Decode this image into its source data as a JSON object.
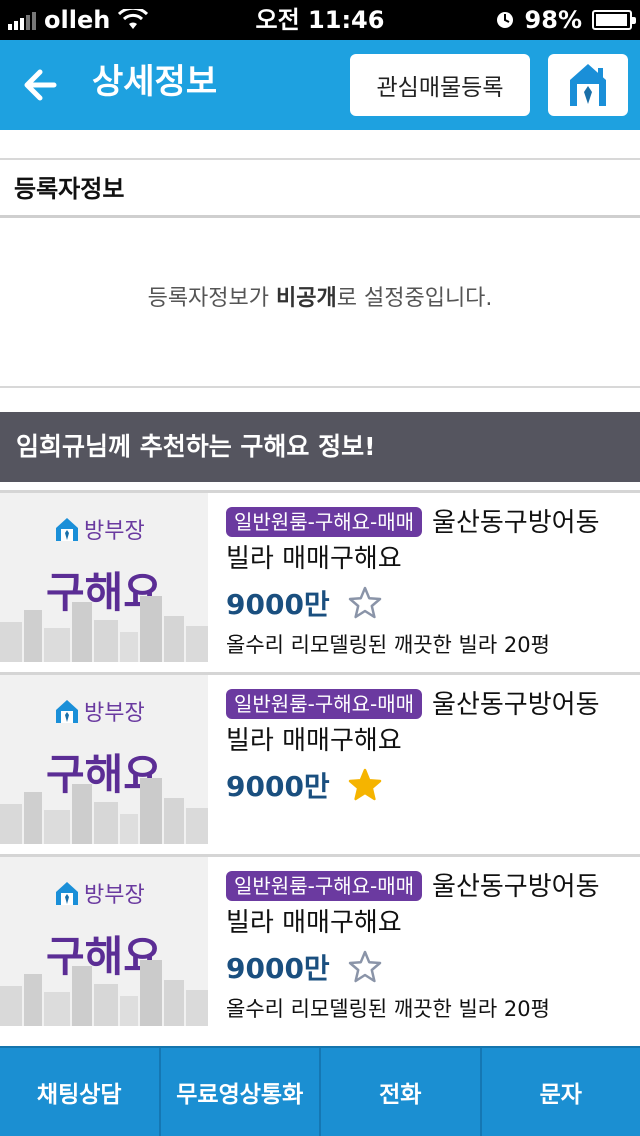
{
  "status_bar": {
    "carrier": "olleh",
    "time": "오전 11:46",
    "battery": "98%",
    "battery_level": 0.98
  },
  "header": {
    "title": "상세정보",
    "favorite_button": "관심매물등록",
    "back_icon": "back-arrow-icon",
    "home_icon": "home-icon"
  },
  "registrant": {
    "heading": "등록자정보",
    "message_prefix": "등록자정보가 ",
    "message_bold": "비공개",
    "message_suffix": "로 설정중입니다."
  },
  "recommend": {
    "title": "임희규님께 추천하는 구해요 정보!"
  },
  "listings": [
    {
      "brand": "방부장",
      "badge": "구해요",
      "tag": "일반원룸-구해요-매매",
      "title": "울산동구방어동 빌라 매매구해요",
      "price": "9000만",
      "starred": false,
      "description": "올수리 리모델링된 깨끗한 빌라 20평"
    },
    {
      "brand": "방부장",
      "badge": "구해요",
      "tag": "일반원룸-구해요-매매",
      "title": "울산동구방어동 빌라 매매구해요",
      "price": "9000만",
      "starred": true,
      "description": ""
    },
    {
      "brand": "방부장",
      "badge": "구해요",
      "tag": "일반원룸-구해요-매매",
      "title": "울산동구방어동 빌라 매매구해요",
      "price": "9000만",
      "starred": false,
      "description": "올수리 리모델링된 깨끗한 빌라 20평"
    }
  ],
  "bottom_bar": {
    "tabs": [
      "채팅상담",
      "무료영상통화",
      "전화",
      "문자"
    ]
  },
  "colors": {
    "header_blue": "#1ea1e0",
    "tag_purple": "#6b3aa0",
    "price_blue": "#1a4f7f",
    "star_gold": "#f5b400",
    "banner_gray": "#55555f"
  }
}
